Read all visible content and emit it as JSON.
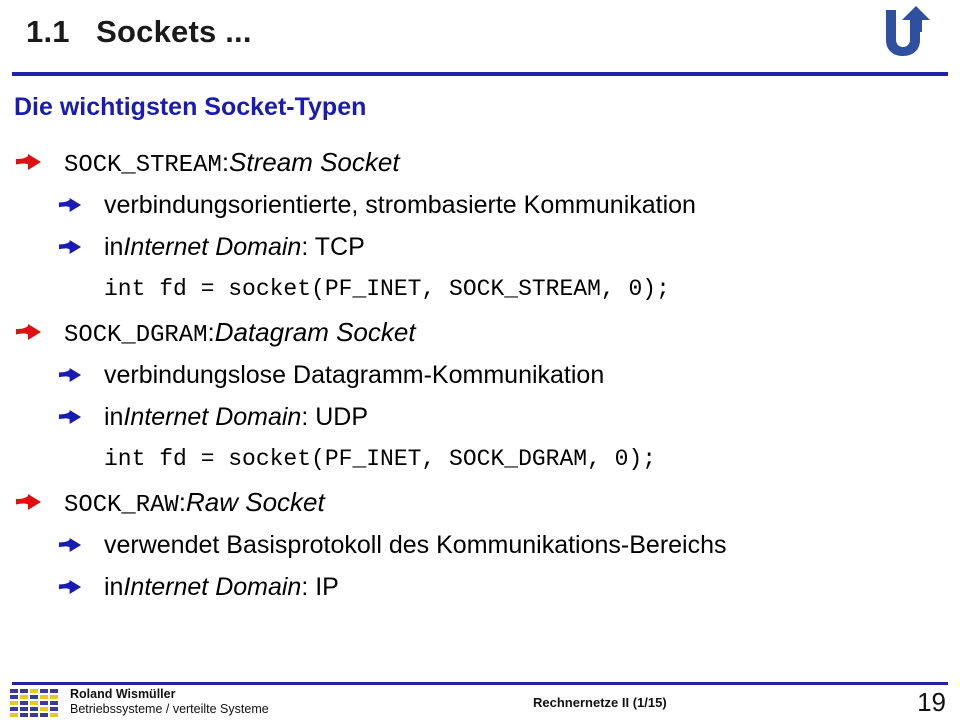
{
  "header": {
    "title": "1.1   Sockets ...",
    "logo_icon": "university-u-arrow-logo",
    "rule_color": "#2222a8"
  },
  "section": {
    "heading": "Die wichtigsten Socket-Typen",
    "heading_color": "#1a1ab4"
  },
  "bullets": {
    "level1_icon": "red-arrow-bullet-icon",
    "level1_color": "#e01010",
    "level2_icon": "blue-arrow-bullet-icon",
    "level2_color": "#1a1ab4"
  },
  "lines": [
    {
      "level": 1,
      "code": "SOCK_STREAM",
      "sep": ": ",
      "italic": "Stream Socket",
      "plain": ""
    },
    {
      "level": 2,
      "code": "",
      "sep": "",
      "italic": "",
      "plain": "verbindungsorientierte, strombasierte Kommunikation"
    },
    {
      "level": 2,
      "code": "",
      "sep": "",
      "italic": "Internet Domain",
      "plain": "in ",
      "tail": ": TCP"
    },
    {
      "level": 0,
      "codeline": "int fd = socket(PF_INET, SOCK_STREAM, 0);"
    },
    {
      "level": 1,
      "code": "SOCK_DGRAM",
      "sep": ": ",
      "italic": "Datagram Socket",
      "plain": ""
    },
    {
      "level": 2,
      "code": "",
      "sep": "",
      "italic": "",
      "plain": "verbindungslose Datagramm-Kommunikation"
    },
    {
      "level": 2,
      "code": "",
      "sep": "",
      "italic": "Internet Domain",
      "plain": "in ",
      "tail": ": UDP"
    },
    {
      "level": 0,
      "codeline": "int fd = socket(PF_INET, SOCK_DGRAM, 0);"
    },
    {
      "level": 1,
      "code": "SOCK_RAW",
      "sep": ": ",
      "italic": "Raw Socket",
      "plain": ""
    },
    {
      "level": 2,
      "code": "",
      "sep": "",
      "italic": "",
      "plain": "verwendet Basisprotokoll des Kommunikations-Bereichs"
    },
    {
      "level": 2,
      "code": "",
      "sep": "",
      "italic": "Internet Domain",
      "plain": "in ",
      "tail": ": IP"
    }
  ],
  "footer": {
    "logo_icon": "checkered-blue-yellow-logo",
    "author": "Roland Wismüller",
    "department": "Betriebssysteme / verteilte Systeme",
    "course": "Rechnernetze II (1/15)",
    "page_number": "19",
    "rule_color": "#2222a8"
  }
}
